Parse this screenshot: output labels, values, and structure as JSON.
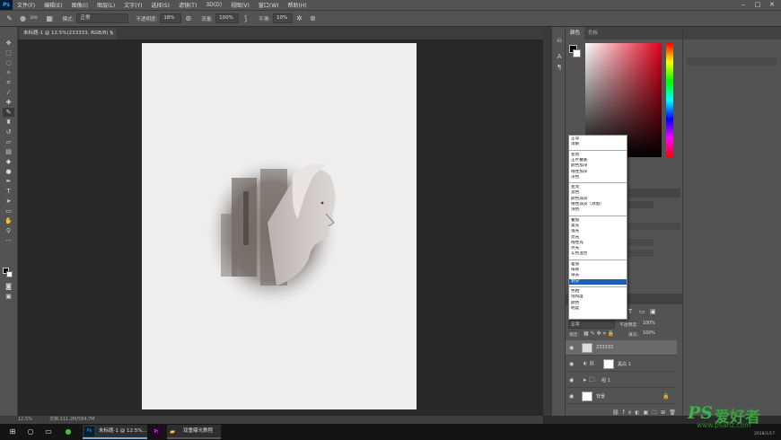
{
  "menubar": {
    "logo": "Ps",
    "items": [
      "文件(F)",
      "编辑(E)",
      "图像(I)",
      "图层(L)",
      "文字(Y)",
      "选择(S)",
      "滤镜(T)",
      "3D(D)",
      "视图(V)",
      "窗口(W)",
      "帮助(H)"
    ]
  },
  "options": {
    "size": "300",
    "mode_label": "模式:",
    "mode_value": "正常",
    "opacity_label": "不透明度:",
    "opacity_value": "18%",
    "flow_label": "流量:",
    "flow_value": "100%",
    "smooth_label": "平滑:",
    "smooth_value": "10%"
  },
  "document": {
    "tab_title": "未标题-1 @ 12.5%(233333, RGB/8) *",
    "zoom": "12.5%",
    "doc_size": "文档:111.2M/584.7M"
  },
  "color_panel": {
    "tabs": [
      "颜色",
      "色板"
    ]
  },
  "blend_menu": {
    "groups": [
      [
        "正常",
        "溶解"
      ],
      [
        "变暗",
        "正片叠底",
        "颜色加深",
        "线性加深",
        "深色"
      ],
      [
        "变亮",
        "滤色",
        "颜色减淡",
        "线性减淡（添加）",
        "浅色"
      ],
      [
        "叠加",
        "柔光",
        "强光",
        "亮光",
        "线性光",
        "点光",
        "实色混合"
      ],
      [
        "差值",
        "排除",
        "减去",
        "划分"
      ],
      [
        "色相",
        "饱和度",
        "颜色",
        "明度"
      ]
    ],
    "selected": "划分"
  },
  "layers_panel": {
    "blend_mode": "正常",
    "opacity_label": "不透明度:",
    "opacity_value": "100%",
    "lock_label": "锁定:",
    "fill_label": "填充:",
    "fill_value": "100%",
    "layers": [
      {
        "name": "233333",
        "selected": true
      },
      {
        "name": "黑白 1",
        "selected": false
      },
      {
        "name": "组 1",
        "selected": false
      },
      {
        "name": "背景",
        "selected": false
      }
    ]
  },
  "taskbar": {
    "apps": [
      "未标题-1 @ 12.5%...",
      "双重曝光教程"
    ]
  },
  "watermark": {
    "brand": "PS",
    "cn": "爱好者",
    "url": "www.psahz.com"
  },
  "clock": "2018/1/17"
}
